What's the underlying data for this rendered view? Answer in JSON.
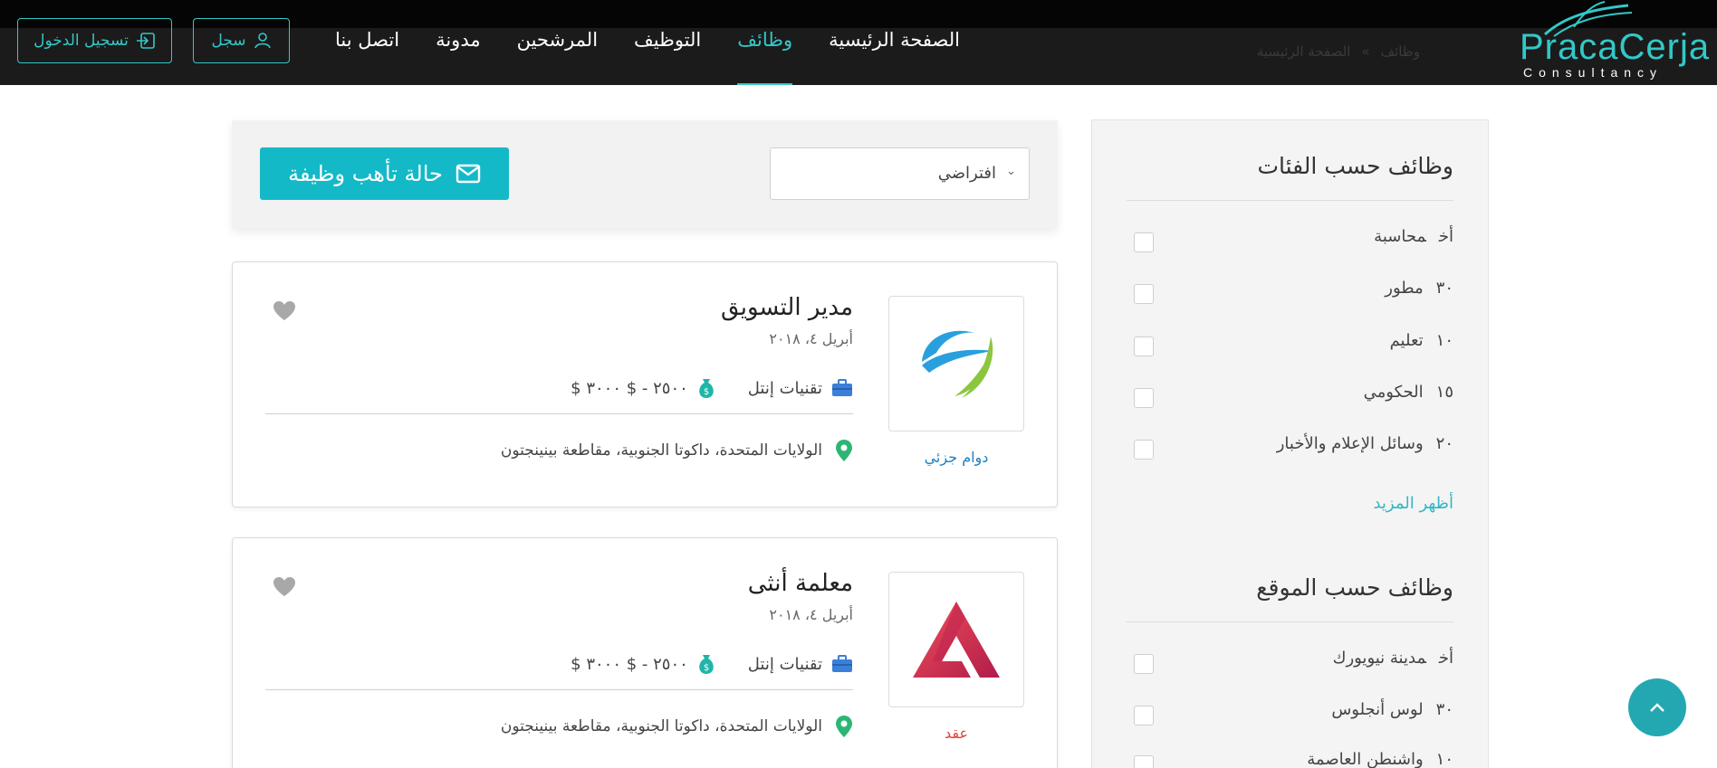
{
  "brand": {
    "name": "PracaCerja",
    "tagline": "Consultancy",
    "accent": "#33c8c8"
  },
  "header": {
    "ghost_breadcrumb": {
      "home": "الصفحة الرئيسية",
      "separator": "»",
      "current": "وظائف"
    },
    "nav": [
      {
        "label": "الصفحة الرئيسية",
        "active": false
      },
      {
        "label": "وظائف",
        "active": true
      },
      {
        "label": "التوظيف",
        "active": false
      },
      {
        "label": "المرشحين",
        "active": false
      },
      {
        "label": "مدونة",
        "active": false
      },
      {
        "label": "اتصل بنا",
        "active": false
      }
    ],
    "register_label": "سجل",
    "login_label": "تسجيل الدخول"
  },
  "sidebar": {
    "categories_title": "وظائف حسب الفئات",
    "categories": [
      {
        "count": "أخ",
        "label": "محاسبة"
      },
      {
        "count": "٣٠",
        "label": "مطور"
      },
      {
        "count": "١٠",
        "label": "تعليم"
      },
      {
        "count": "١٥",
        "label": "الحكومي"
      },
      {
        "count": "٢٠",
        "label": "وسائل الإعلام والأخبار"
      }
    ],
    "show_more": "أظهر المزيد",
    "location_title": "وظائف حسب الموقع",
    "locations": [
      {
        "count": "أخ",
        "label": "مدينة نيويورك"
      },
      {
        "count": "٣٠",
        "label": "لوس أنجلوس"
      },
      {
        "count": "١٠",
        "label": "واشنطن العاصمة"
      }
    ]
  },
  "filter": {
    "sort_value": "افتراضي",
    "job_alert_label": "حالة تأهب وظيفة"
  },
  "jobs": [
    {
      "title": "مدير التسويق",
      "date": "أبريل ٤، ٢٠١٨",
      "company": "تقنيات إنتل",
      "salary": "$ ٢٥٠٠ - $ ٣٠٠٠",
      "location": "الولايات المتحدة، داكوتا الجنوبية، مقاطعة بينينجتون",
      "type": "دوام جزئي",
      "type_color": "#1e7fc4",
      "logo_icon": "swirl-globe-logo"
    },
    {
      "title": "معلمة أنثى",
      "date": "أبريل ٤، ٢٠١٨",
      "company": "تقنيات إنتل",
      "salary": "$ ٢٥٠٠ - $ ٣٠٠٠",
      "location": "الولايات المتحدة، داكوتا الجنوبية، مقاطعة بينينجتون",
      "type": "عقد",
      "type_color": "#e0403a",
      "logo_icon": "triangle-logo"
    }
  ]
}
